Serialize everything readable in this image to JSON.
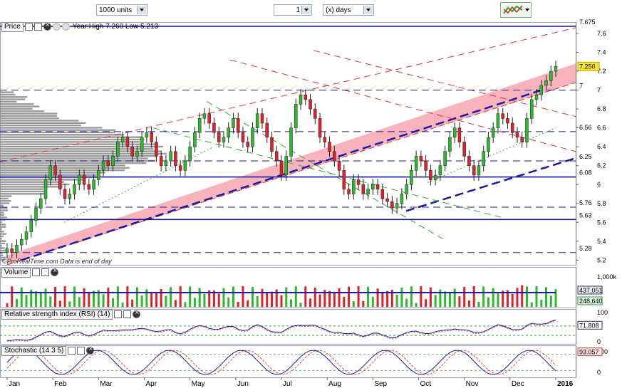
{
  "toolbar": {
    "units_select": "1000 units",
    "period_value": "1",
    "period_select": "(x) days"
  },
  "price_panel": {
    "label": "Price",
    "info": "Year:High 7.260 Low 5.213",
    "watermark": "©ProRealTime.com  Data is end of day",
    "last_price": "7.250"
  },
  "volume_panel": {
    "label": "Volume",
    "values": [
      "1,000k",
      "437,051",
      "248,640"
    ]
  },
  "rsi_panel": {
    "label": "Relative strength index (RSI) (14)",
    "values": [
      "100",
      "71.808",
      "0"
    ]
  },
  "stoch_panel": {
    "label": "Stochastic (14 3 5)",
    "values": [
      "100",
      "93.057",
      "0"
    ]
  },
  "colors": {
    "up": "#2db82d",
    "down": "#e0202a",
    "band_fill": "#f7a7ae",
    "blue_line": "#1a1aa8",
    "profile": "#8a8a8a"
  },
  "chart_data": {
    "type": "candlestick",
    "ylim": [
      5.15,
      7.72
    ],
    "y_ticks": [
      "5.2",
      "5.4",
      "5.6",
      "5.8",
      "6",
      "6.2",
      "6.4",
      "6.6",
      "6.8",
      "7",
      "7.2",
      "7.4",
      "7.6"
    ],
    "x_ticks": [
      "Jan",
      "Feb",
      "Mar",
      "Apr",
      "May",
      "Jun",
      "Jul",
      "Aug",
      "Sep",
      "Oct",
      "Nov",
      "Dec",
      "2016"
    ],
    "horizontal_levels": [
      {
        "label": "7.675",
        "value": 7.675,
        "style": "solid"
      },
      {
        "label": "7",
        "value": 7.0,
        "style": "dashed"
      },
      {
        "label": "6.56",
        "value": 6.56,
        "style": "dashed"
      },
      {
        "label": "6.25",
        "value": 6.25,
        "style": "dashed"
      },
      {
        "label": "6.08",
        "value": 6.08,
        "style": "solid"
      },
      {
        "label": "5.76",
        "value": 5.76,
        "style": "dashed"
      },
      {
        "label": "5.63",
        "value": 5.63,
        "style": "solid"
      },
      {
        "label": "5.28",
        "value": 5.28,
        "style": "dashed"
      }
    ],
    "closes": [
      5.32,
      5.28,
      5.36,
      5.42,
      5.5,
      5.62,
      5.75,
      5.85,
      6.05,
      6.2,
      6.1,
      5.95,
      5.85,
      5.9,
      6.0,
      6.1,
      6.0,
      5.95,
      6.05,
      6.15,
      6.25,
      6.2,
      6.3,
      6.45,
      6.5,
      6.4,
      6.3,
      6.35,
      6.5,
      6.55,
      6.45,
      6.3,
      6.2,
      6.25,
      6.35,
      6.2,
      6.15,
      6.25,
      6.4,
      6.55,
      6.7,
      6.75,
      6.65,
      6.55,
      6.45,
      6.5,
      6.6,
      6.7,
      6.55,
      6.45,
      6.4,
      6.6,
      6.75,
      6.65,
      6.5,
      6.35,
      6.25,
      6.1,
      6.3,
      6.6,
      6.85,
      6.95,
      6.9,
      6.8,
      6.7,
      6.5,
      6.45,
      6.35,
      6.25,
      6.15,
      5.95,
      5.9,
      6.05,
      6.0,
      5.9,
      5.95,
      6.0,
      5.95,
      5.85,
      5.82,
      5.75,
      5.8,
      5.9,
      6.0,
      6.15,
      6.3,
      6.25,
      6.15,
      6.05,
      6.1,
      6.2,
      6.35,
      6.5,
      6.6,
      6.45,
      6.3,
      6.2,
      6.1,
      6.2,
      6.35,
      6.5,
      6.6,
      6.75,
      6.7,
      6.65,
      6.55,
      6.5,
      6.45,
      6.7,
      6.9,
      6.95,
      7.05,
      7.1,
      7.2,
      7.25
    ],
    "volume_avg": 437051,
    "volume_last": 248640,
    "rsi_last": 71.808,
    "stochastic_last": 93.057
  }
}
